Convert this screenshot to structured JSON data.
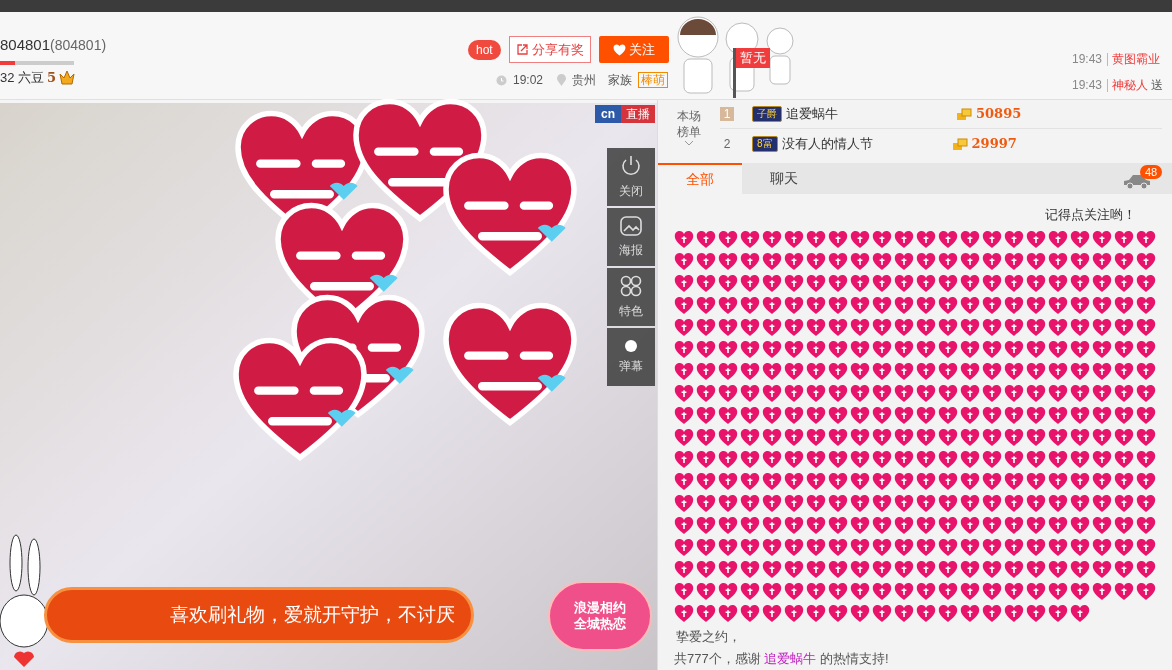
{
  "header": {
    "room_title": "804801",
    "room_id": "(804801)",
    "progress": {
      "level": 0.2
    },
    "beans": "32 六豆",
    "rank_number": "5",
    "hot_badge": "hot",
    "share_button": "分享有奖",
    "follow_button": "关注",
    "time": "19:02",
    "location": "贵州",
    "family_label": "家族",
    "family_badge": "棒萌",
    "flag": "暂无"
  },
  "ticker": [
    {
      "time": "19:43",
      "user": "黄图霸业"
    },
    {
      "time": "19:43",
      "user": "神秘人",
      "text": "送"
    }
  ],
  "video": {
    "logo": "cn",
    "live_badge": "直播",
    "controls": [
      {
        "kind": "power",
        "label": "关闭"
      },
      {
        "kind": "picture",
        "label": "海报"
      },
      {
        "kind": "clover",
        "label": "特色"
      },
      {
        "kind": "dot",
        "label": "弹幕"
      }
    ],
    "banner": "喜欢刷礼物，爱就开守护，不讨厌",
    "promo": [
      "浪漫相约",
      "全城热恋"
    ]
  },
  "leaderboard": {
    "title": "本场榜单",
    "rows": [
      {
        "rank": "1",
        "badge": "子爵",
        "name": "追爱蜗牛",
        "score": "50895"
      },
      {
        "rank": "2",
        "badge": "8富",
        "name": "没有人的情人节",
        "score": "29997"
      }
    ]
  },
  "chat": {
    "tabs": [
      {
        "label": "全部",
        "selected": true
      },
      {
        "label": "聊天",
        "selected": false
      }
    ],
    "car_badge": "48",
    "notice": "记得点关注哟！",
    "gift_message": {
      "gift_name": "挚爱之约，",
      "prefix": "共777个，感谢",
      "sender": "追爱蜗牛",
      "suffix": "的热情支持!"
    }
  }
}
